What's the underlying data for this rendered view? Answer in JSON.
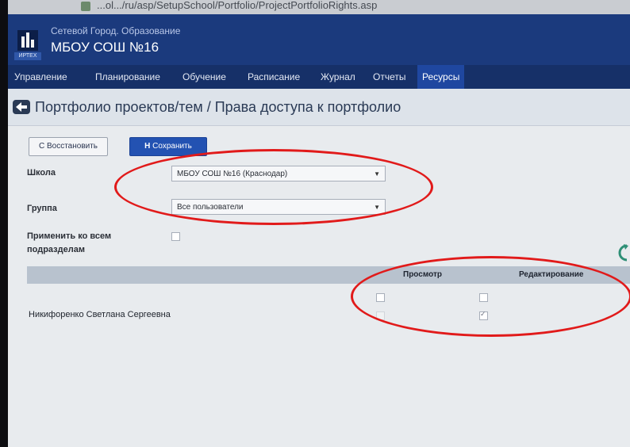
{
  "browser": {
    "url": "...ol.../ru/asp/SetupSchool/Portfolio/ProjectPortfolioRights.asp"
  },
  "header": {
    "app_name": "Сетевой Город. Образование",
    "school": "МБОУ СОШ №16",
    "logo_caption": "ИРТЕХ"
  },
  "nav": {
    "items": [
      {
        "label": "Управление"
      },
      {
        "label": "Планирование"
      },
      {
        "label": "Обучение"
      },
      {
        "label": "Расписание"
      },
      {
        "label": "Журнал"
      },
      {
        "label": "Отчеты"
      },
      {
        "label": "Ресурсы",
        "active": true
      }
    ]
  },
  "page": {
    "title": "Портфолио проектов/тем / Права доступа к портфолио",
    "restore_label": "С Восстановить",
    "save_label": "Сохранить"
  },
  "form": {
    "school_label": "Школа",
    "school_value": "МБОУ СОШ №16 (Краснодар)",
    "group_label": "Группа",
    "group_value": "Все пользователи",
    "apply_label_line1": "Применить ко всем",
    "apply_label_line2": "подразделам",
    "apply_checked": false
  },
  "table": {
    "columns": [
      "Просмотр",
      "Редактирование"
    ],
    "header_row_checks": [
      false,
      false
    ],
    "rows": [
      {
        "name": "Никифоренко Светлана Сергеевна",
        "view": false,
        "edit": true
      }
    ]
  },
  "colors": {
    "header_bg": "#1b3a7d",
    "nav_active": "#1f47a0",
    "save_button": "#2352b2",
    "annotation_red": "#e11a1a"
  }
}
